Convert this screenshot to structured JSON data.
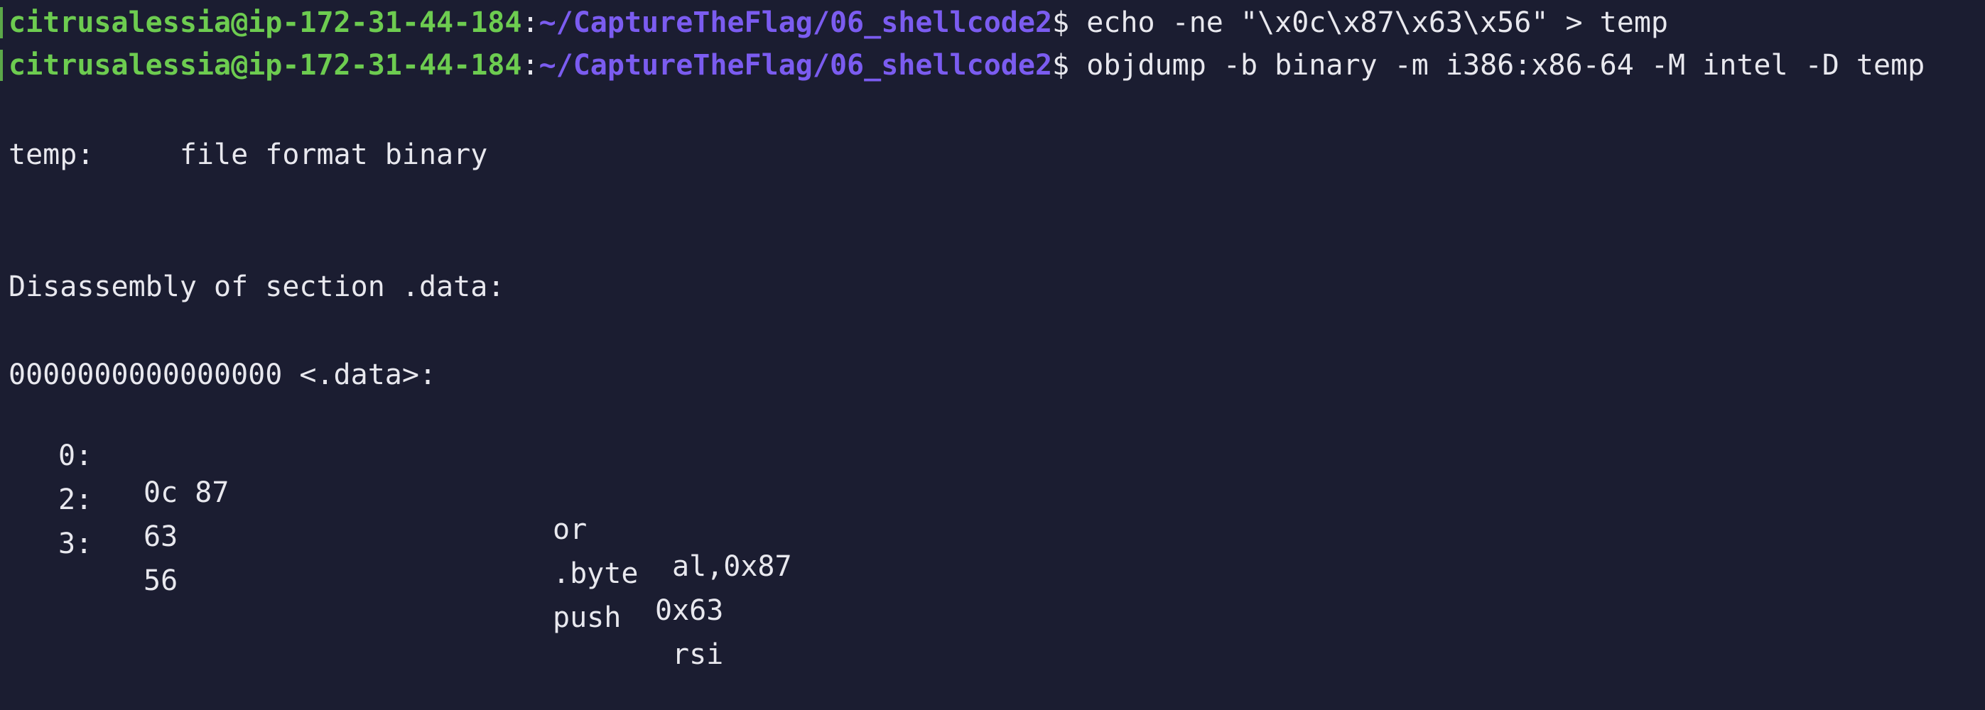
{
  "prompts": [
    {
      "user_host": "citrusalessia@ip-172-31-44-184",
      "sep": ":",
      "path": "~/CaptureTheFlag/06_shellcode2",
      "dollar": "$",
      "command": " echo -ne \"\\x0c\\x87\\x63\\x56\" > temp"
    },
    {
      "user_host": "citrusalessia@ip-172-31-44-184",
      "sep": ":",
      "path": "~/CaptureTheFlag/06_shellcode2",
      "dollar": "$",
      "command": " objdump -b binary -m i386:x86-64 -M intel -D temp"
    }
  ],
  "output": {
    "file_format": "temp:     file format binary",
    "disassembly_header": "Disassembly of section .data:",
    "symbol_line": "0000000000000000 <.data>:",
    "instructions": [
      {
        "offset": "0:",
        "bytes": "0c 87",
        "mnemonic": "or",
        "operands": "al,0x87"
      },
      {
        "offset": "2:",
        "bytes": "63",
        "mnemonic": ".byte",
        "operands": "0x63"
      },
      {
        "offset": "3:",
        "bytes": "56",
        "mnemonic": "push",
        "operands": "rsi"
      }
    ]
  }
}
